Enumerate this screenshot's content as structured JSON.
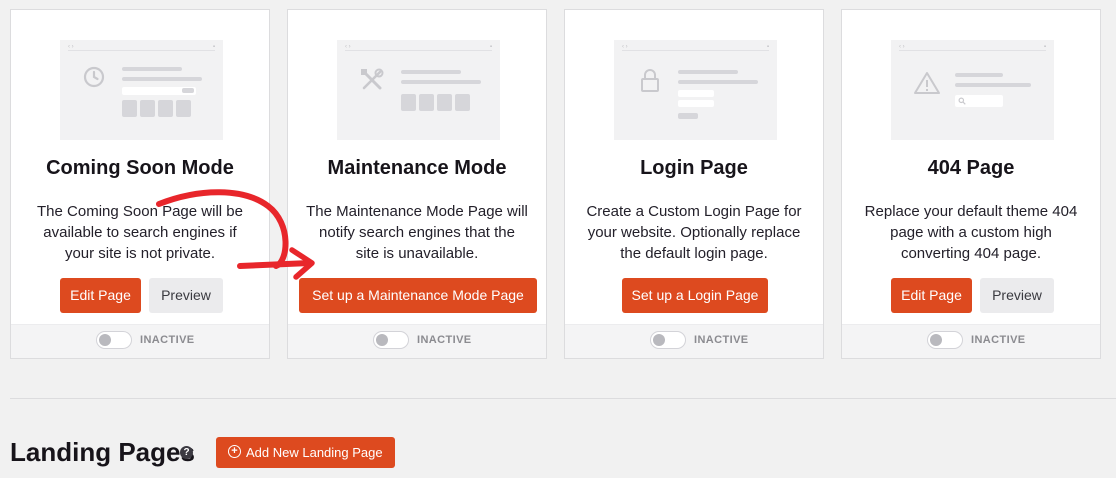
{
  "status_inactive": "INACTIVE",
  "cards": [
    {
      "title": "Coming Soon Mode",
      "description": "The Coming Soon Page will be available to search engines if your site is not private.",
      "buttons": [
        "Edit Page",
        "Preview"
      ],
      "icon": "clock-icon"
    },
    {
      "title": "Maintenance Mode",
      "description": "The Maintenance Mode Page will notify search engines that the site is unavailable.",
      "buttons": [
        "Set up a Maintenance Mode Page"
      ],
      "icon": "tools-icon"
    },
    {
      "title": "Login Page",
      "description": "Create a Custom Login Page for your website. Optionally replace the default login page.",
      "buttons": [
        "Set up a Login Page"
      ],
      "icon": "lock-icon"
    },
    {
      "title": "404 Page",
      "description": "Replace your default theme 404 page with a custom high converting 404 page.",
      "buttons": [
        "Edit Page",
        "Preview"
      ],
      "icon": "warning-icon"
    }
  ],
  "landing": {
    "heading": "Landing Pages",
    "help_glyph": "?",
    "add_button": "Add New Landing Page",
    "add_icon": "plus-circle-icon"
  },
  "annotation": {
    "color": "#e8262b",
    "icon": "curved-arrow-icon"
  },
  "colors": {
    "accent": "#dd4a1f",
    "secondary": "#ebebed"
  }
}
